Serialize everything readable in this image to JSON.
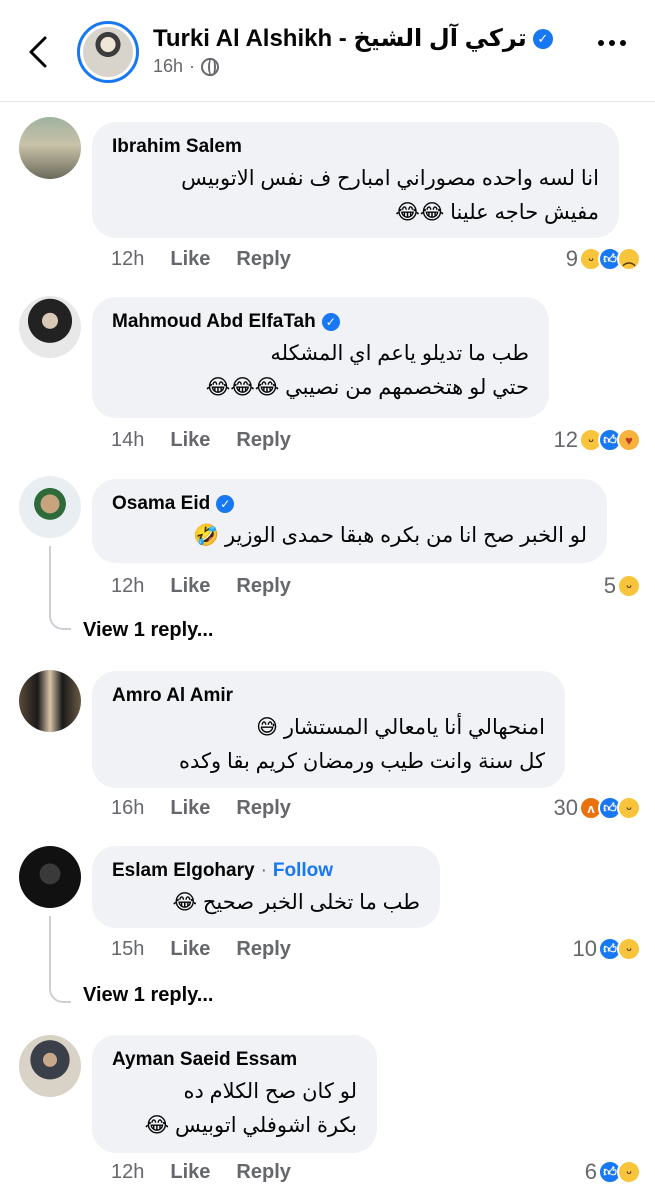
{
  "post": {
    "author_name": "Turki Al Alshikh - تركي آل الشيخ",
    "time": "16h",
    "separator": "·"
  },
  "actions": {
    "like": "Like",
    "reply": "Reply"
  },
  "comments": [
    {
      "author": "Ibrahim Salem",
      "verified": false,
      "lines": [
        "انا لسه واحده مصوراني امبارح ف نفس الاتوبيس",
        "مفيش حاجه علينا 😂😂"
      ],
      "time": "12h",
      "reaction_count": "9",
      "reactions": [
        "haha",
        "like",
        "sad"
      ]
    },
    {
      "author": "Mahmoud Abd ElfaTah",
      "verified": true,
      "lines": [
        "طب ما تديلو ياعم اي المشكله",
        "حتي لو هتخصمهم من نصيبي 😂😂😂"
      ],
      "time": "14h",
      "reaction_count": "12",
      "reactions": [
        "haha",
        "like",
        "care"
      ]
    },
    {
      "author": "Osama Eid",
      "verified": true,
      "lines": [
        "لو الخبر صح انا من بكره هبقا حمدى الوزير 🤣"
      ],
      "time": "12h",
      "reaction_count": "5",
      "reactions": [
        "haha"
      ],
      "view_replies": "View 1 reply..."
    },
    {
      "author": "Amro Al Amir",
      "verified": false,
      "lines": [
        "امنحهالي أنا يامعالي المستشار 😅",
        "كل سنة وانت طيب ورمضان كريم بقا وكده"
      ],
      "time": "16h",
      "reaction_count": "30",
      "reactions": [
        "angry",
        "like",
        "haha"
      ]
    },
    {
      "author": "Eslam Elgohary",
      "follow": "Follow",
      "verified": false,
      "lines": [
        "طب ما تخلى الخبر صحيح 😂"
      ],
      "time": "15h",
      "reaction_count": "10",
      "reactions": [
        "like",
        "haha"
      ],
      "view_replies": "View 1 reply..."
    },
    {
      "author": "Ayman Saeid Essam",
      "verified": false,
      "lines": [
        "لو كان صح الكلام ده",
        "بكرة اشوفلي اتوبيس 😂"
      ],
      "time": "12h",
      "reaction_count": "6",
      "reactions": [
        "like",
        "haha"
      ]
    }
  ],
  "icons": {
    "back": "chevron-left-icon",
    "verified": "verified-badge-icon",
    "audience": "globe-icon",
    "more": "more-dots-icon"
  },
  "colors": {
    "accent": "#1877f2",
    "bubble": "#f0f2f5",
    "meta": "#65676b"
  }
}
